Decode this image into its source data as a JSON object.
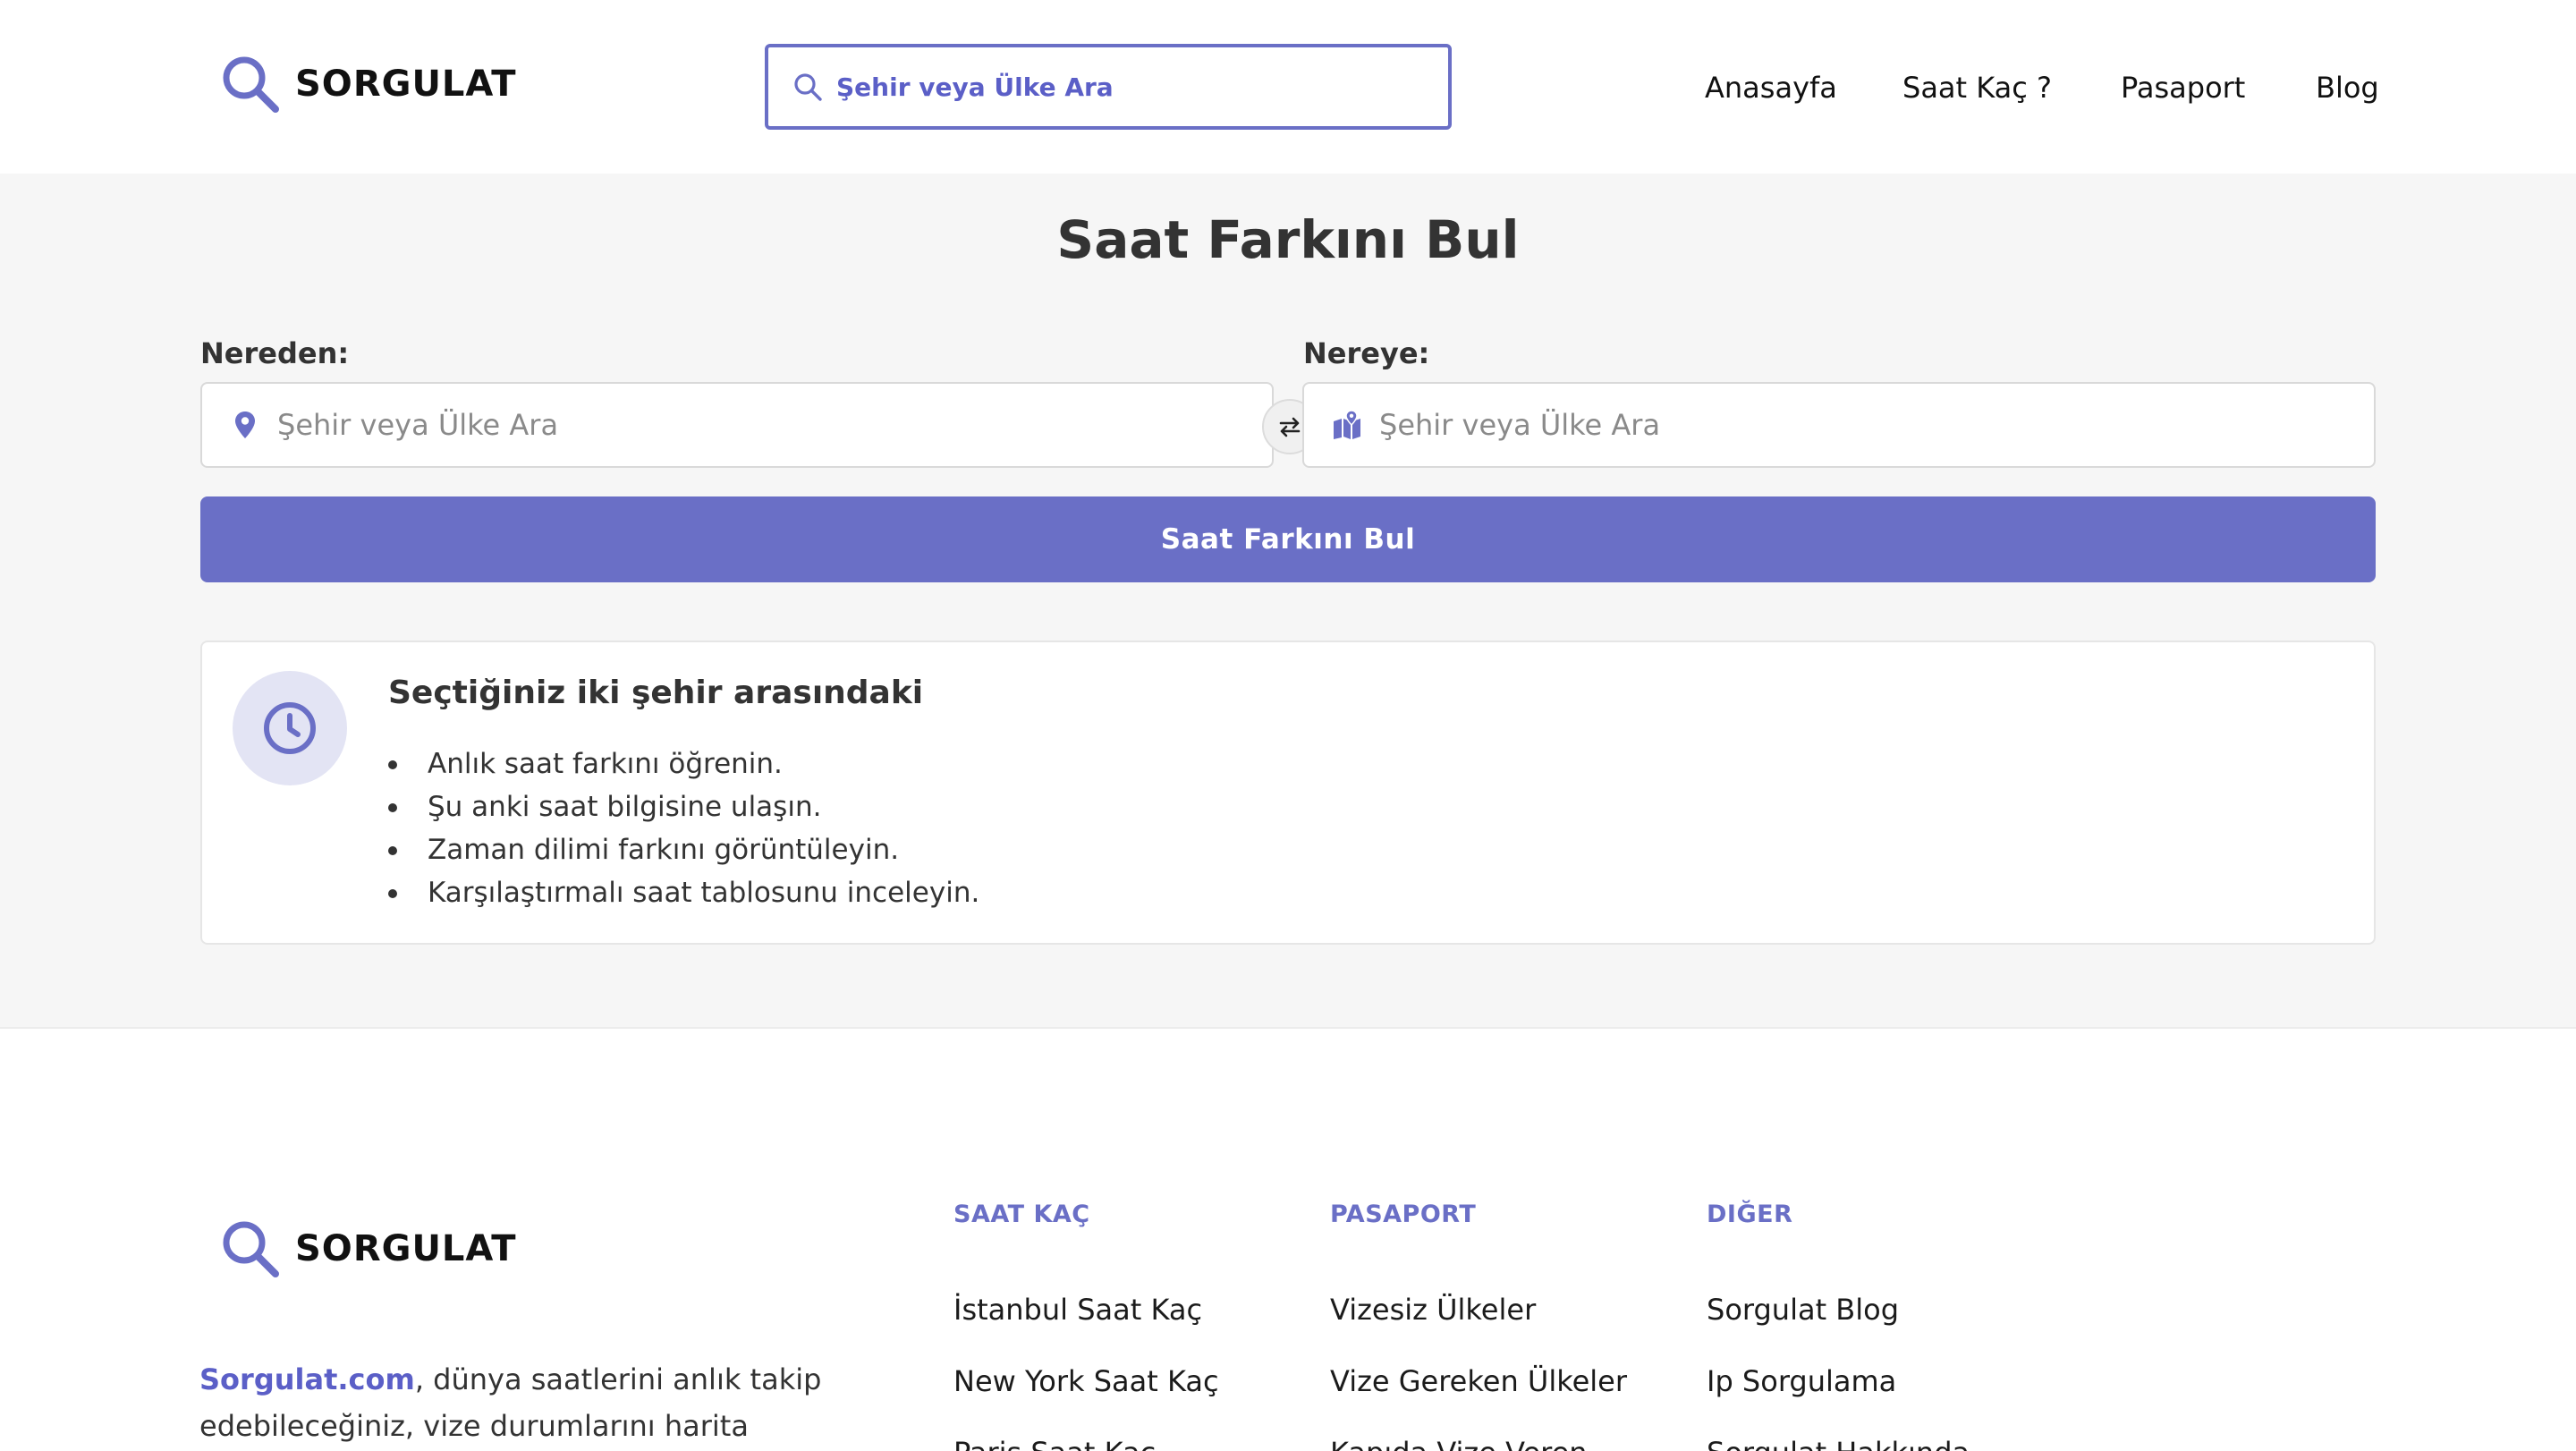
{
  "header": {
    "logo_text": "SORGULAT",
    "search_placeholder": "Şehir veya Ülke Ara",
    "nav": [
      "Anasayfa",
      "Saat Kaç ?",
      "Pasaport",
      "Blog"
    ]
  },
  "main": {
    "title": "Saat Farkını Bul",
    "from_label": "Nereden:",
    "to_label": "Nereye:",
    "from_placeholder": "Şehir veya Ülke Ara",
    "to_placeholder": "Şehir veya Ülke Ara",
    "submit_label": "Saat Farkını Bul",
    "info": {
      "title": "Seçtiğiniz iki şehir arasındaki",
      "items": [
        "Anlık saat farkını öğrenin.",
        "Şu anki saat bilgisine ulaşın.",
        "Zaman dilimi farkını görüntüleyin.",
        "Karşılaştırmalı saat tablosunu inceleyin."
      ]
    }
  },
  "footer": {
    "logo_text": "SORGULAT",
    "desc_brand": "Sorgulat.com",
    "desc_text": ", dünya saatlerini anlık takip edebileceğiniz, vize durumlarını harita",
    "columns": [
      {
        "heading": "SAAT KAÇ",
        "links": [
          "İstanbul Saat Kaç",
          "New York Saat Kaç",
          "Paris Saat Kaç"
        ]
      },
      {
        "heading": "PASAPORT",
        "links": [
          "Vizesiz Ülkeler",
          "Vize Gereken Ülkeler",
          "Kapıda Vize Veren"
        ]
      },
      {
        "heading": "DIĞER",
        "links": [
          "Sorgulat Blog",
          "Ip Sorgulama",
          "Sorgulat Hakkında"
        ]
      }
    ]
  },
  "colors": {
    "accent": "#6a6fc6",
    "accent_text": "#5b5fc7",
    "background": "#f6f6f6",
    "icon_circle": "#e3e4f4"
  },
  "icons": {
    "logo": "search-icon",
    "from_field": "map-pin-icon",
    "to_field": "map-icon",
    "swap": "swap-arrows-icon",
    "info": "clock-icon"
  }
}
